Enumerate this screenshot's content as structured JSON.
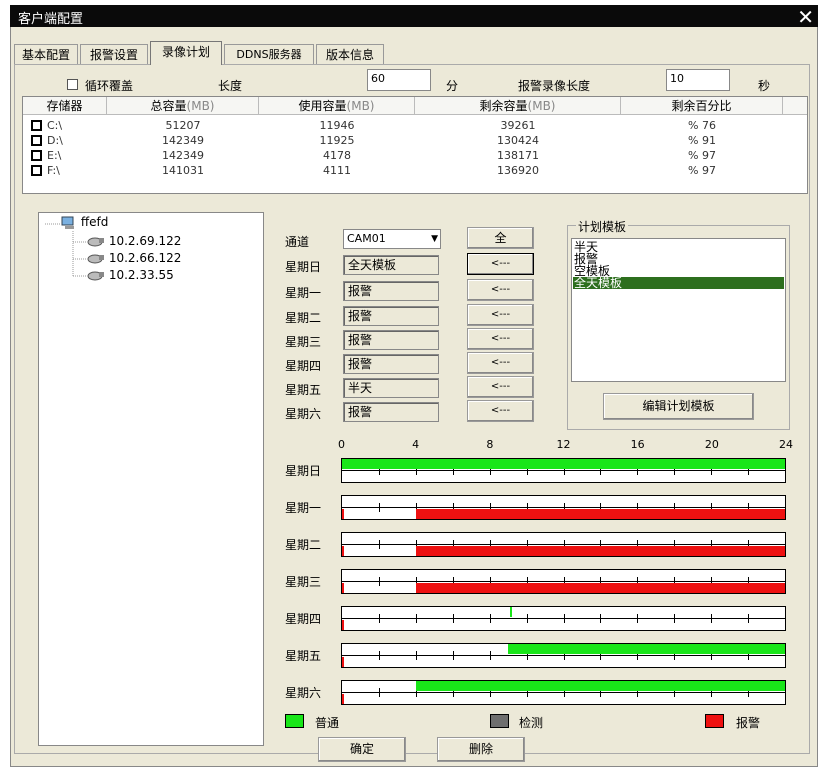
{
  "window": {
    "title": "客户端配置",
    "close_glyph": "✕"
  },
  "tabs": [
    "基本配置",
    "报警设置",
    "录像计划",
    "DDNS服务器",
    "版本信息"
  ],
  "top_row": {
    "loop_label": "循环覆盖",
    "length_label": "长度",
    "length_value": "60",
    "minute_unit": "分",
    "alarm_len_label": "报警录像长度",
    "alarm_len_value": "10",
    "second_unit": "秒"
  },
  "storage_table": {
    "headers": [
      "存储器",
      "总容量",
      "使用容量",
      "剩余容量",
      "剩余百分比"
    ],
    "unit": "(MB)",
    "rows": [
      [
        "C:\\",
        "51207",
        "11946",
        "39261",
        "% 76"
      ],
      [
        "D:\\",
        "142349",
        "11925",
        "130424",
        "% 91"
      ],
      [
        "E:\\",
        "142349",
        "4178",
        "138171",
        "% 97"
      ],
      [
        "F:\\",
        "141031",
        "4111",
        "136920",
        "% 97"
      ]
    ]
  },
  "tree": {
    "root": "ffefd",
    "children": [
      "10.2.69.122",
      "10.2.66.122",
      "10.2.33.55"
    ]
  },
  "channel": {
    "label": "通道",
    "value": "CAM01",
    "all_button": "全"
  },
  "days": [
    {
      "label": "星期日",
      "template": "全天模板"
    },
    {
      "label": "星期一",
      "template": "报警"
    },
    {
      "label": "星期二",
      "template": "报警"
    },
    {
      "label": "星期三",
      "template": "报警"
    },
    {
      "label": "星期四",
      "template": "报警"
    },
    {
      "label": "星期五",
      "template": "半天"
    },
    {
      "label": "星期六",
      "template": "报警"
    }
  ],
  "apply_button": "<---",
  "template_panel": {
    "title": "计划模板",
    "items": [
      "半天",
      "报警",
      "空模板",
      "全天模板"
    ],
    "selected": "全天模板",
    "edit_button": "编辑计划模板"
  },
  "timeline": {
    "ticks": [
      "0",
      "4",
      "8",
      "12",
      "16",
      "20",
      "24"
    ],
    "hours_range": [
      0,
      24
    ],
    "colors": {
      "normal": "#19e619",
      "detect": "#6f6f6f",
      "alarm": "#ee1111"
    },
    "rows": [
      {
        "label": "星期日",
        "normal": [
          [
            0,
            24
          ]
        ],
        "alarm": []
      },
      {
        "label": "星期一",
        "normal": [],
        "alarm": [
          [
            4,
            24
          ]
        ]
      },
      {
        "label": "星期二",
        "normal": [],
        "alarm": [
          [
            4,
            24
          ]
        ]
      },
      {
        "label": "星期三",
        "normal": [],
        "alarm": [
          [
            4,
            24
          ]
        ]
      },
      {
        "label": "星期四",
        "normal": [
          [
            9.1,
            9.2
          ]
        ],
        "alarm": []
      },
      {
        "label": "星期五",
        "normal": [
          [
            9,
            24
          ]
        ],
        "alarm": []
      },
      {
        "label": "星期六",
        "normal": [
          [
            4,
            24
          ]
        ],
        "alarm": []
      }
    ]
  },
  "legend": {
    "normal": "普通",
    "detect": "检测",
    "alarm": "报警"
  },
  "buttons": {
    "ok": "确定",
    "delete": "删除"
  }
}
